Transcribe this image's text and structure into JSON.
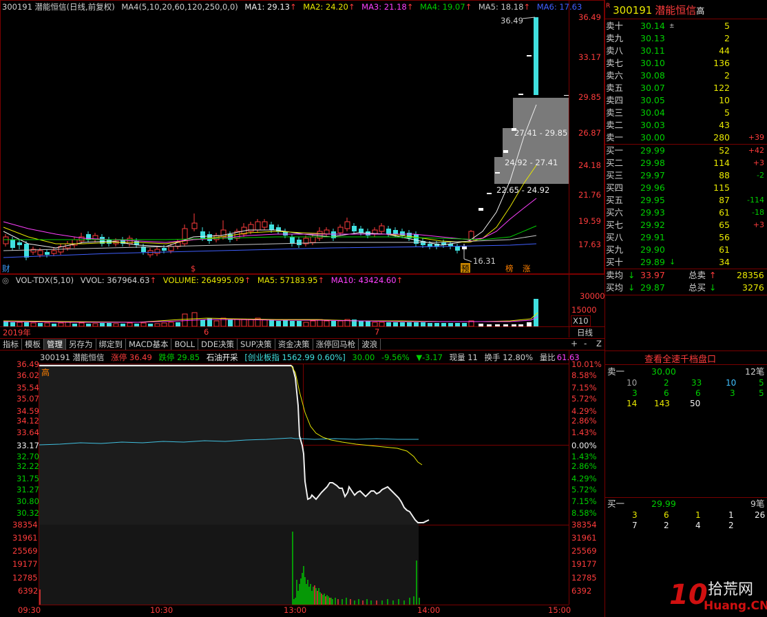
{
  "colors": {
    "up": "#ff3c3c",
    "down": "#40e0e0",
    "flat": "#ffffff",
    "grid": "#7a0000"
  },
  "kline_header": {
    "code_name": "300191 潜能恒信(日线,前复权)",
    "ma_label": "MA4(5,10,20,60,120,250,0,0)",
    "ma": [
      {
        "label": "MA1: 29.13",
        "color": "#f0f0f0"
      },
      {
        "label": "MA2: 24.20",
        "color": "#e8e800"
      },
      {
        "label": "MA3: 21.18",
        "color": "#ff40ff"
      },
      {
        "label": "MA4: 19.07",
        "color": "#00d000"
      },
      {
        "label": "MA5: 18.18",
        "color": "#c8c8c8"
      },
      {
        "label": "MA6: 17.63",
        "color": "#4060ff"
      }
    ]
  },
  "kline_axis": [
    "36.49",
    "33.17",
    "29.85",
    "26.87",
    "24.18",
    "21.76",
    "19.59",
    "17.63"
  ],
  "kline_annotations": {
    "high": "36.49",
    "low": "16.31",
    "zone1": "27.41 - 29.85",
    "zone2": "24.92 - 27.41",
    "zone3": "22.65 - 24.92",
    "badges": [
      "财",
      "$",
      "预",
      "榜",
      "涨"
    ]
  },
  "vol_header": {
    "label": "VOL-TDX(5,10)",
    "vvol": "VVOL: 367964.63",
    "volume": "VOLUME: 264995.09",
    "ma5": "MA5: 57183.95",
    "ma10": "MA10: 43424.60"
  },
  "vol_axis": [
    "30000",
    "15000"
  ],
  "vol_unit": "X10",
  "date_axis": {
    "year": "2019年",
    "m6": "6",
    "m7": "7",
    "period": "日线"
  },
  "tabs": [
    "指标",
    "模板",
    "管理",
    "另存为",
    "绑定到",
    "MACD基本",
    "BOLL",
    "DDE决策",
    "SUP决策",
    "资金决策",
    "涨停回马枪",
    "波浪"
  ],
  "tabs_active": 2,
  "tab_right": [
    "+",
    "-",
    "Z"
  ],
  "intraday_header": {
    "code": "300191 潜能恒信",
    "zt": "涨停 36.49",
    "dt": "跌停 29.85",
    "sector": "石油开采",
    "index": "[创业板指 1562.99 0.60%]",
    "price": "30.00",
    "pct": "-9.56%",
    "chg": "▼-3.17",
    "xl": "现量 11",
    "hs": "换手 12.80%",
    "lb": "量比",
    "lb_val": "61.63"
  },
  "intraday_tag": "高",
  "intraday_price_axis": [
    "36.49",
    "36.02",
    "35.54",
    "35.07",
    "34.59",
    "34.12",
    "33.64",
    "33.17",
    "32.70",
    "32.22",
    "31.75",
    "31.27",
    "30.80",
    "30.32"
  ],
  "intraday_pct_axis": [
    "10.01%",
    "8.58%",
    "7.15%",
    "5.72%",
    "4.29%",
    "2.86%",
    "1.43%",
    "0.00%",
    "1.43%",
    "2.86%",
    "4.29%",
    "5.72%",
    "7.15%",
    "8.58%"
  ],
  "intraday_vol_axis": [
    "38354",
    "31961",
    "25569",
    "19177",
    "12785",
    "6392"
  ],
  "time_axis": [
    "09:30",
    "10:30",
    "13:00",
    "14:00",
    "15:00"
  ],
  "quote": {
    "code": "300191",
    "name": "潜能恒信",
    "tag": "高",
    "sell": [
      {
        "label": "卖十",
        "price": "30.14",
        "flag": "±",
        "vol": "5",
        "chg": ""
      },
      {
        "label": "卖九",
        "price": "30.13",
        "flag": "",
        "vol": "2",
        "chg": ""
      },
      {
        "label": "卖八",
        "price": "30.11",
        "flag": "",
        "vol": "44",
        "chg": ""
      },
      {
        "label": "卖七",
        "price": "30.10",
        "flag": "",
        "vol": "136",
        "chg": ""
      },
      {
        "label": "卖六",
        "price": "30.08",
        "flag": "",
        "vol": "2",
        "chg": ""
      },
      {
        "label": "卖五",
        "price": "30.07",
        "flag": "",
        "vol": "122",
        "chg": ""
      },
      {
        "label": "卖四",
        "price": "30.05",
        "flag": "",
        "vol": "10",
        "chg": ""
      },
      {
        "label": "卖三",
        "price": "30.04",
        "flag": "",
        "vol": "5",
        "chg": ""
      },
      {
        "label": "卖二",
        "price": "30.03",
        "flag": "",
        "vol": "43",
        "chg": ""
      },
      {
        "label": "卖一",
        "price": "30.00",
        "flag": "",
        "vol": "280",
        "chg": "+39"
      }
    ],
    "buy": [
      {
        "label": "买一",
        "price": "29.99",
        "vol": "52",
        "chg": "+42"
      },
      {
        "label": "买二",
        "price": "29.98",
        "vol": "114",
        "chg": "+3"
      },
      {
        "label": "买三",
        "price": "29.97",
        "vol": "88",
        "chg": "-2"
      },
      {
        "label": "买四",
        "price": "29.96",
        "vol": "115",
        "chg": ""
      },
      {
        "label": "买五",
        "price": "29.95",
        "vol": "87",
        "chg": "-114"
      },
      {
        "label": "买六",
        "price": "29.93",
        "vol": "61",
        "chg": "-18"
      },
      {
        "label": "买七",
        "price": "29.92",
        "vol": "65",
        "chg": "+3"
      },
      {
        "label": "买八",
        "price": "29.91",
        "vol": "56",
        "chg": ""
      },
      {
        "label": "买九",
        "price": "29.90",
        "vol": "61",
        "chg": ""
      },
      {
        "label": "买十",
        "price": "29.89",
        "vol": "34",
        "chg": ""
      }
    ],
    "avg_sell_label": "卖均",
    "avg_sell": "33.97",
    "total_sell_label": "总卖",
    "total_sell": "28356",
    "avg_buy_label": "买均",
    "avg_buy": "29.87",
    "total_buy_label": "总买",
    "total_buy": "3276"
  },
  "depth": {
    "title": "查看全速千档盘口",
    "sell_label": "卖一",
    "sell_price": "30.00",
    "sell_count": "12笔",
    "sell_rows": [
      [
        "10",
        "2",
        "33",
        "10",
        "5"
      ],
      [
        "3",
        "6",
        "6",
        "3",
        "5"
      ],
      [
        "14",
        "143",
        "50"
      ]
    ],
    "buy_label": "买一",
    "buy_price": "29.99",
    "buy_count": "9笔",
    "buy_rows": [
      [
        "3",
        "6",
        "1",
        "1",
        "26"
      ],
      [
        "7",
        "2",
        "4",
        "2"
      ]
    ]
  },
  "watermark": {
    "num": "10",
    "cn": "拾荒网",
    "url": "Huang.CN"
  }
}
